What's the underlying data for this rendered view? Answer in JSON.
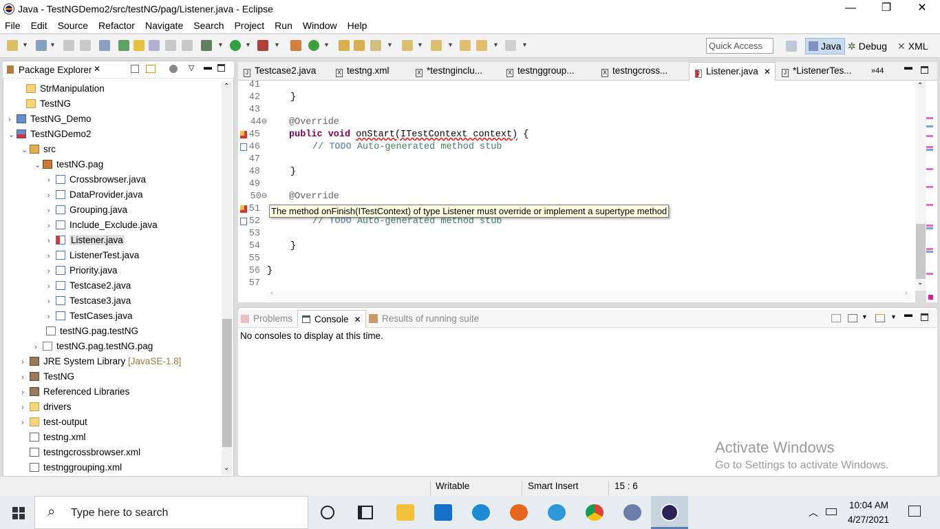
{
  "window": {
    "title": "Java - TestNGDemo2/src/testNG/pag/Listener.java - Eclipse",
    "minimize": "—",
    "maximize": "❐",
    "close": "✕"
  },
  "menu": [
    "File",
    "Edit",
    "Source",
    "Refactor",
    "Navigate",
    "Search",
    "Project",
    "Run",
    "Window",
    "Help"
  ],
  "toolbar": {
    "quick_access_placeholder": "Quick Access",
    "perspectives": [
      "Java",
      "Debug",
      "XML"
    ]
  },
  "package_explorer": {
    "title": "Package Explorer",
    "items": [
      {
        "label": "StrManipulation",
        "icon": "folder-icon"
      },
      {
        "label": "TestNG",
        "icon": "folder-icon"
      },
      {
        "label": "TestNG_Demo",
        "icon": "project-icon"
      },
      {
        "label": "TestNGDemo2",
        "icon": "project-error-icon"
      },
      {
        "label": "src",
        "icon": "source-folder-icon"
      },
      {
        "label": "testNG.pag",
        "icon": "package-icon"
      },
      {
        "label": "Crossbrowser.java",
        "icon": "java-file-icon"
      },
      {
        "label": "DataProvider.java",
        "icon": "java-file-icon"
      },
      {
        "label": "Grouping.java",
        "icon": "java-file-icon"
      },
      {
        "label": "Include_Exclude.java",
        "icon": "java-file-icon"
      },
      {
        "label": "Listener.java",
        "icon": "java-file-error-icon"
      },
      {
        "label": "ListenerTest.java",
        "icon": "java-file-icon"
      },
      {
        "label": "Priority.java",
        "icon": "java-file-icon"
      },
      {
        "label": "Testcase2.java",
        "icon": "java-file-icon"
      },
      {
        "label": "Testcase3.java",
        "icon": "java-file-icon"
      },
      {
        "label": "TestCases.java",
        "icon": "java-file-icon"
      },
      {
        "label": "testNG.pag.testNG",
        "icon": "package-icon"
      },
      {
        "label": "testNG.pag.testNG.pag",
        "icon": "package-icon"
      },
      {
        "label": "JRE System Library",
        "suffix": "[JavaSE-1.8]",
        "icon": "library-icon"
      },
      {
        "label": "TestNG",
        "icon": "library-icon"
      },
      {
        "label": "Referenced Libraries",
        "icon": "library-icon"
      },
      {
        "label": "drivers",
        "icon": "folder-icon"
      },
      {
        "label": "test-output",
        "icon": "folder-icon"
      },
      {
        "label": "testng.xml",
        "icon": "xml-file-icon"
      },
      {
        "label": "testngcrossbrowser.xml",
        "icon": "xml-file-icon"
      },
      {
        "label": "testnggrouping.xml",
        "icon": "xml-file-icon"
      }
    ]
  },
  "editor_tabs": [
    "Testcase2.java",
    "testng.xml",
    "*testnginclu...",
    "testnggroup...",
    "testngcross...",
    "Listener.java",
    "*ListenerTes...",
    "»44"
  ],
  "code": {
    "line_numbers": [
      "41",
      "42",
      "43",
      "44⊖",
      "45",
      "46",
      "47",
      "48",
      "49",
      "50⊖",
      "51",
      "52",
      "53",
      "54",
      "55",
      "56",
      "57"
    ],
    "l42": "}",
    "l44": "@Override",
    "l45_kw": "public void ",
    "l45_method": "onStart(ITestContext context)",
    "l45_end": " {",
    "l46_pre": "// ",
    "l46_todo": "TODO",
    "l46_rest": " Auto-generated method stub",
    "l48": "}",
    "l50": "@Override",
    "l52_pre": "// ",
    "l52_todo": "TODO",
    "l52_rest": " Auto-generated method stub",
    "l54": "}",
    "l56": "}"
  },
  "tooltip": "The method onFinish(ITestContext) of type Listener must override or implement a supertype method",
  "bottom_tabs": [
    "Problems",
    "Console",
    "Results of running suite"
  ],
  "console_message": "No consoles to display at this time.",
  "watermark": {
    "line1": "Activate Windows",
    "line2": "Go to Settings to activate Windows."
  },
  "status": {
    "writable": "Writable",
    "insert": "Smart Insert",
    "position": "15 : 6"
  },
  "taskbar": {
    "search_placeholder": "Type here to search",
    "time": "10:04 AM",
    "date": "4/27/2021"
  }
}
